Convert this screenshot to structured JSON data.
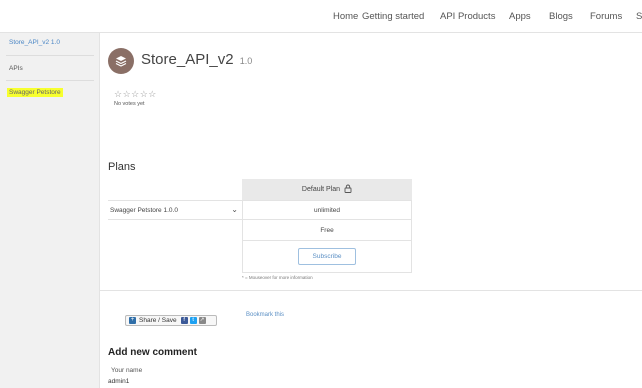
{
  "nav": {
    "items": [
      "Home",
      "Getting started",
      "API Products",
      "Apps",
      "Blogs",
      "Forums",
      "S"
    ]
  },
  "sidebar": {
    "items": [
      {
        "label": "Store_API_v2 1.0",
        "color": "#4a86c5"
      },
      {
        "label": "APIs",
        "color": "#555555"
      },
      {
        "label": "Swagger Petstore",
        "color": "#666666",
        "highlight": "#f7ff2e"
      }
    ]
  },
  "api": {
    "title": "Store_API_v2",
    "version": "1.0",
    "stars": "☆☆☆☆☆",
    "votes": "No votes yet",
    "logo_color": "#8a6f66"
  },
  "plans": {
    "heading": "Plans",
    "header": "Default Plan",
    "product_label": "Swagger Petstore 1.0.0",
    "quota": "unlimited",
    "price": "Free",
    "subscribe": "Subscribe",
    "footnote": "* = Mouseover for more information"
  },
  "share": {
    "label": "Share / Save",
    "bookmark": "Bookmark this"
  },
  "comment": {
    "heading": "Add new comment",
    "name_label": "Your name",
    "name_value": "admin1"
  }
}
